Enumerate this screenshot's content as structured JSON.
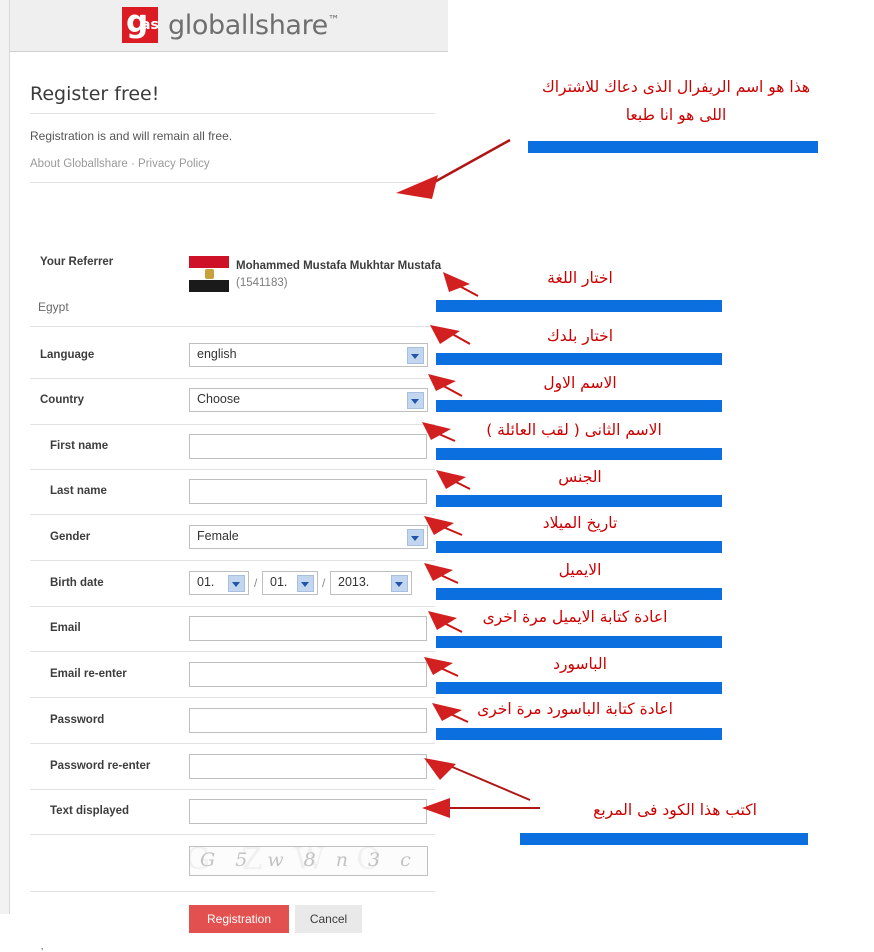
{
  "header": {
    "logo_g": "g",
    "logo_as": "as",
    "logo_text": "globallshare",
    "logo_tm": "™"
  },
  "page": {
    "title": "Register free!",
    "subtitle": "Registration is and will remain all free.",
    "link_about": "About Globallshare",
    "link_sep": " · ",
    "link_privacy": "Privacy Policy",
    "tiny_mark": "‚"
  },
  "referrer": {
    "label": "Your Referrer",
    "name": "Mohammed Mustafa Mukhtar Mustafa",
    "id": "(1541183)",
    "country": "Egypt",
    "flag_name": "egypt-flag-icon"
  },
  "form": {
    "rows": [
      {
        "label": "Language",
        "type": "select",
        "value": "english"
      },
      {
        "label": "Country",
        "type": "select",
        "value": "Choose"
      },
      {
        "label": "First name",
        "type": "text",
        "value": ""
      },
      {
        "label": "Last name",
        "type": "text",
        "value": ""
      },
      {
        "label": "Gender",
        "type": "select",
        "value": "Female"
      },
      {
        "label": "Birth date",
        "type": "date",
        "value": ""
      },
      {
        "label": "Email",
        "type": "text",
        "value": ""
      },
      {
        "label": "Email re-enter",
        "type": "text",
        "value": ""
      },
      {
        "label": "Password",
        "type": "text",
        "value": ""
      },
      {
        "label": "Password re-enter",
        "type": "text",
        "value": ""
      },
      {
        "label": "Text displayed",
        "type": "text",
        "value": ""
      }
    ],
    "birth_date": {
      "day": "01.",
      "month": "01.",
      "year": "2013.",
      "sep1": "/",
      "sep2": "/"
    },
    "captcha": {
      "text": "G 5 w 8 n 3 c",
      "noise": "G Z W O A E"
    },
    "submit_label": "Registration",
    "cancel_label": "Cancel"
  },
  "annotations": [
    {
      "line1": "هذا هو اسم الريفرال الذى دعاك للاشتراك",
      "line2": "اللى هو انا طبعا"
    },
    {
      "line1": "اختار اللغة"
    },
    {
      "line1": "اختار بلدك"
    },
    {
      "line1": "الاسم الاول"
    },
    {
      "line1": "الاسم الثانى ( لقب العائلة )"
    },
    {
      "line1": "الجنس"
    },
    {
      "line1": "تاريخ الميلاد"
    },
    {
      "line1": "الايميل"
    },
    {
      "line1": "اعادة كتابة الايميل مرة اخرى"
    },
    {
      "line1": "الباسورد"
    },
    {
      "line1": "اعادة كتابة الباسورد مرة اخرى"
    },
    {
      "line1": "اكتب هذا الكود فى المربع"
    }
  ],
  "colors": {
    "annotation_red": "#cc0000",
    "arrow_red": "#cc1111",
    "highlight_blue": "#0b6fe0",
    "logo_red": "#dc1c24",
    "submit_red": "#e2504f"
  }
}
